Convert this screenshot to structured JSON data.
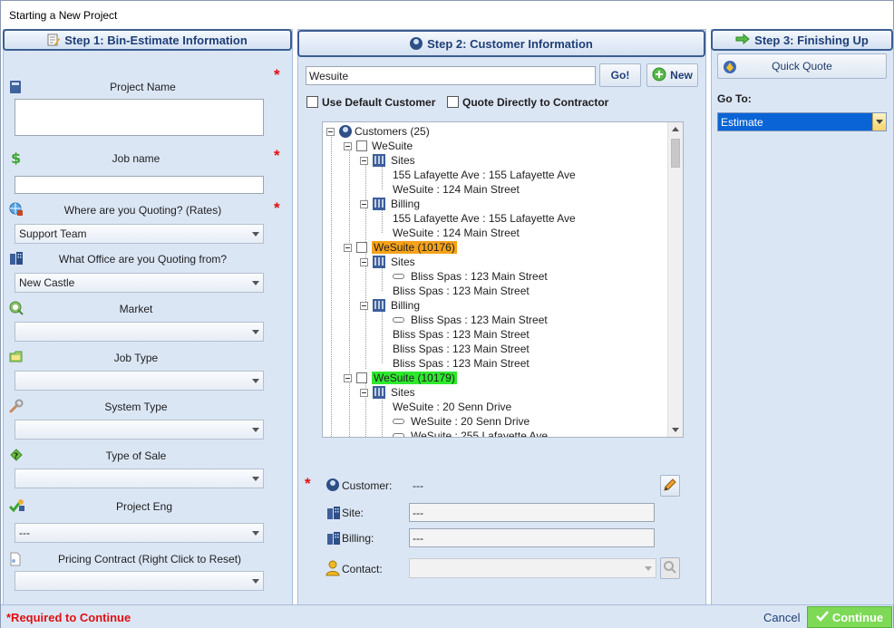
{
  "window": {
    "title": "Starting a New Project"
  },
  "step1": {
    "title": "Step 1: Bin-Estimate Information",
    "fields": {
      "project_name": {
        "label": "Project Name",
        "value": ""
      },
      "job_name": {
        "label": "Job name",
        "value": ""
      },
      "where_quoting": {
        "label": "Where are you Quoting? (Rates)",
        "value": "Support Team"
      },
      "office": {
        "label": "What Office are you Quoting from?",
        "value": "New Castle"
      },
      "market": {
        "label": "Market",
        "value": ""
      },
      "job_type": {
        "label": "Job Type",
        "value": ""
      },
      "system_type": {
        "label": "System Type",
        "value": ""
      },
      "type_of_sale": {
        "label": "Type of Sale",
        "value": ""
      },
      "project_eng": {
        "label": "Project Eng",
        "value": "---"
      },
      "pricing_contract": {
        "label": "Pricing Contract (Right Click to Reset)",
        "value": ""
      }
    },
    "required_mark": "*"
  },
  "step2": {
    "title": "Step 2: Customer Information",
    "search": {
      "value": "Wesuite",
      "go_label": "Go!",
      "new_label": "New"
    },
    "use_default_customer": "Use Default Customer",
    "quote_directly": "Quote Directly to Contractor",
    "tree": {
      "root": "Customers  (25)",
      "nodes": {
        "c1": "WeSuite",
        "c1_sites": "Sites",
        "c1_site1": "155 Lafayette Ave : 155 Lafayette Ave",
        "c1_site2": "WeSuite : 124 Main Street",
        "c1_billing": "Billing",
        "c1_bill1": "155 Lafayette Ave : 155 Lafayette Ave",
        "c1_bill2": "WeSuite : 124 Main Street",
        "c2": "WeSuite (10176)",
        "c2_sites": "Sites",
        "c2_site1": "Bliss Spas : 123 Main Street",
        "c2_site2": "Bliss Spas : 123 Main Street",
        "c2_billing": "Billing",
        "c2_bill1": "Bliss Spas : 123 Main Street",
        "c2_bill2": "Bliss Spas : 123 Main Street",
        "c2_bill3": "Bliss Spas : 123 Main Street",
        "c2_bill4": "Bliss Spas : 123 Main Street",
        "c3": "WeSuite (10179)",
        "c3_sites": "Sites",
        "c3_site1": "WeSuite : 20 Senn Drive",
        "c3_site2": "WeSuite : 20 Senn Drive",
        "c3_site3": "WeSuite : 255 Lafayette Ave"
      },
      "highlight_colors": {
        "c2": "#f5a21a",
        "c3": "#2ee82e"
      }
    },
    "customer": {
      "label": "Customer:",
      "value": "---"
    },
    "site": {
      "label": "Site:",
      "value": "---"
    },
    "billing": {
      "label": "Billing:",
      "value": "---"
    },
    "contact": {
      "label": "Contact:",
      "value": ""
    },
    "required_mark": "*"
  },
  "step3": {
    "title": "Step 3: Finishing Up",
    "quick_quote": "Quick Quote",
    "goto_label": "Go To:",
    "goto_value": "Estimate"
  },
  "footer": {
    "required_note": "*Required to Continue",
    "cancel": "Cancel",
    "continue": "Continue"
  },
  "colors": {
    "panel_bg": "#dbe6f5",
    "header_border": "#3c5e91",
    "required": "#e01010",
    "continue_bg": "#7ed957",
    "select_blue": "#0a64d6"
  }
}
